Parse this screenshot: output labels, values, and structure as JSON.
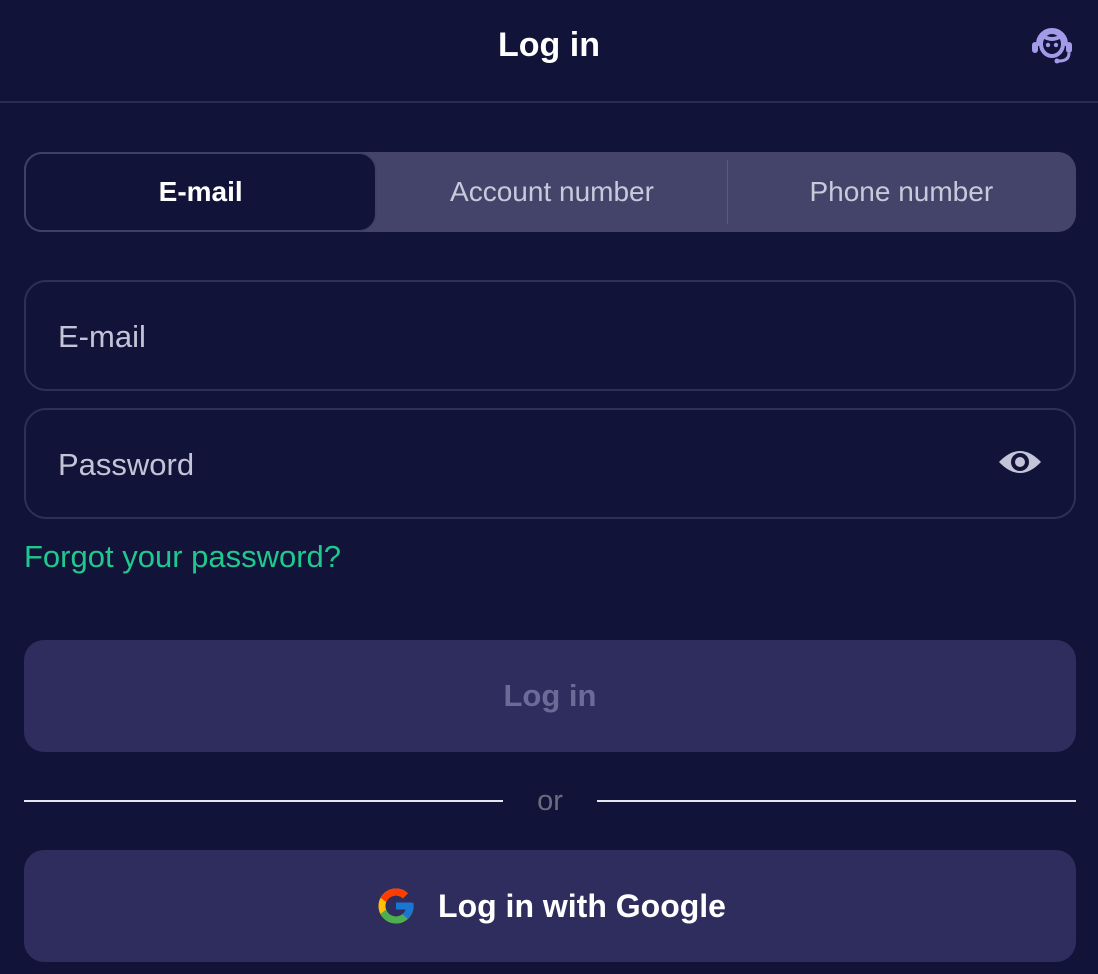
{
  "header": {
    "title": "Log in",
    "support_icon": "support-headset-icon"
  },
  "tabs": [
    {
      "label": "E-mail",
      "active": true
    },
    {
      "label": "Account number",
      "active": false
    },
    {
      "label": "Phone number",
      "active": false
    }
  ],
  "form": {
    "email": {
      "value": "",
      "placeholder": "E-mail"
    },
    "password": {
      "value": "",
      "placeholder": "Password",
      "toggle_icon": "eye-icon"
    },
    "forgot_label": "Forgot your password?",
    "login_label": "Log in",
    "divider_label": "or",
    "google_label": "Log in with Google",
    "google_icon": "google-icon"
  },
  "colors": {
    "background": "#121338",
    "accent": "#1fc98e",
    "button": "#2f2d5e",
    "tab_bar": "#44446a",
    "support_icon": "#a39be8"
  }
}
